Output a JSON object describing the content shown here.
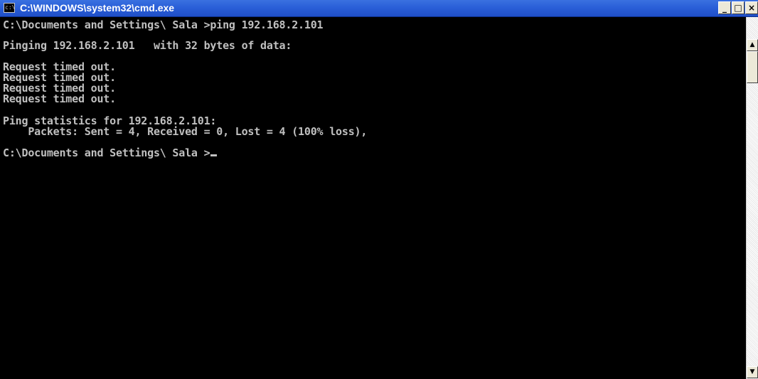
{
  "window": {
    "title": "C:\\WINDOWS\\system32\\cmd.exe",
    "icon": "cmd-icon",
    "buttons": {
      "minimize": "_",
      "maximize": "□",
      "close": "×"
    }
  },
  "console": {
    "lines": [
      "C:\\Documents and Settings\\ Sala >ping 192.168.2.101",
      "Pinging 192.168.2.101   with 32 bytes of data:",
      "Request timed out.",
      "Request timed out.",
      "Request timed out.",
      "Request timed out.",
      "Ping statistics for 192.168.2.101:",
      "    Packets: Sent = 4, Received = 0, Lost = 4 (100% loss),",
      "C:\\Documents and Settings\\ Sala >"
    ],
    "colors": {
      "background": "#000000",
      "text": "#c0c0c0"
    }
  },
  "scrollbar": {
    "up_arrow": "▲",
    "down_arrow": "▼"
  }
}
